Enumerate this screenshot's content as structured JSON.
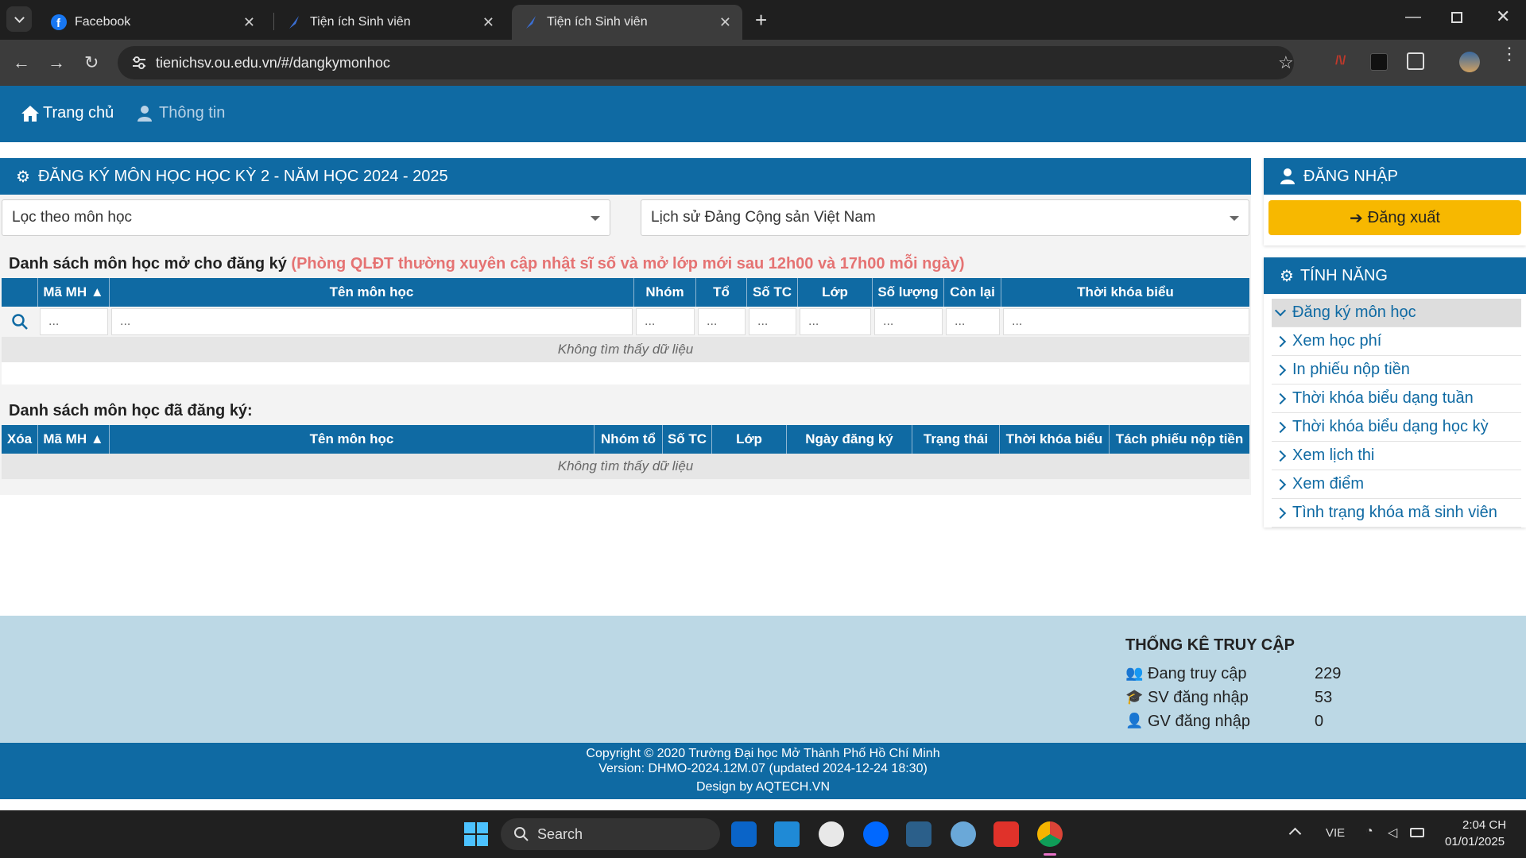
{
  "browser": {
    "tabs": [
      {
        "title": "Facebook"
      },
      {
        "title": "Tiện ích Sinh viên"
      },
      {
        "title": "Tiện ích Sinh viên"
      }
    ],
    "url": "tienichsv.ou.edu.vn/#/dangkymonhoc"
  },
  "nav": {
    "home": "Trang chủ",
    "info": "Thông tin"
  },
  "main": {
    "header": "ĐĂNG KÝ MÔN HỌC HỌC KỲ 2 - NĂM HỌC 2024 - 2025",
    "filter_select": "Lọc theo môn học",
    "course_select": "Lịch sử Đảng Cộng sản Việt Nam",
    "open_title": "Danh sách môn học mở cho đăng ký",
    "open_note": "(Phòng QLĐT thường xuyên cập nhật sĩ số và mở lớp mới sau 12h00 và 17h00 mỗi ngày)",
    "open_columns": [
      "Mã MH ▲",
      "Tên môn học",
      "Nhóm",
      "Tổ",
      "Số TC",
      "Lớp",
      "Số lượng",
      "Còn lại",
      "Thời khóa biểu"
    ],
    "filter_placeholder": "...",
    "empty_text": "Không tìm thấy dữ liệu",
    "registered_title": "Danh sách môn học đã đăng ký:",
    "registered_columns": [
      "Xóa",
      "Mã MH ▲",
      "Tên môn học",
      "Nhóm tổ",
      "Số TC",
      "Lớp",
      "Ngày đăng ký",
      "Trạng thái",
      "Thời khóa biểu",
      "Tách phiếu nộp tiền"
    ]
  },
  "sidebar": {
    "login_header": "ĐĂNG NHẬP",
    "logout_label": "Đăng xuất",
    "features_header": "TÍNH NĂNG",
    "features": [
      "Đăng ký môn học",
      "Xem học phí",
      "In phiếu nộp tiền",
      "Thời khóa biểu dạng tuần",
      "Thời khóa biểu dạng học kỳ",
      "Xem lịch thi",
      "Xem điểm",
      "Tình trạng khóa mã sinh viên"
    ]
  },
  "stats": {
    "title": "THỐNG KÊ TRUY CẬP",
    "rows": [
      {
        "label": "Đang truy cập",
        "value": "229"
      },
      {
        "label": "SV đăng nhập",
        "value": "53"
      },
      {
        "label": "GV đăng nhập",
        "value": "0"
      }
    ]
  },
  "footer": {
    "line1": "Copyright © 2020 Trường Đại học Mở Thành Phố Hồ Chí Minh",
    "line2": "Version: DHMO-2024.12M.07 (updated 2024-12-24 18:30)",
    "line3": "Design by AQTECH.VN"
  },
  "taskbar": {
    "search": "Search",
    "lang": "VIE",
    "time": "2:04 CH",
    "date": "01/01/2025"
  },
  "colors": {
    "primary": "#0f6aa3",
    "accent": "#f7b800",
    "note": "#e57373",
    "stats_bg": "#bcd8e5"
  }
}
